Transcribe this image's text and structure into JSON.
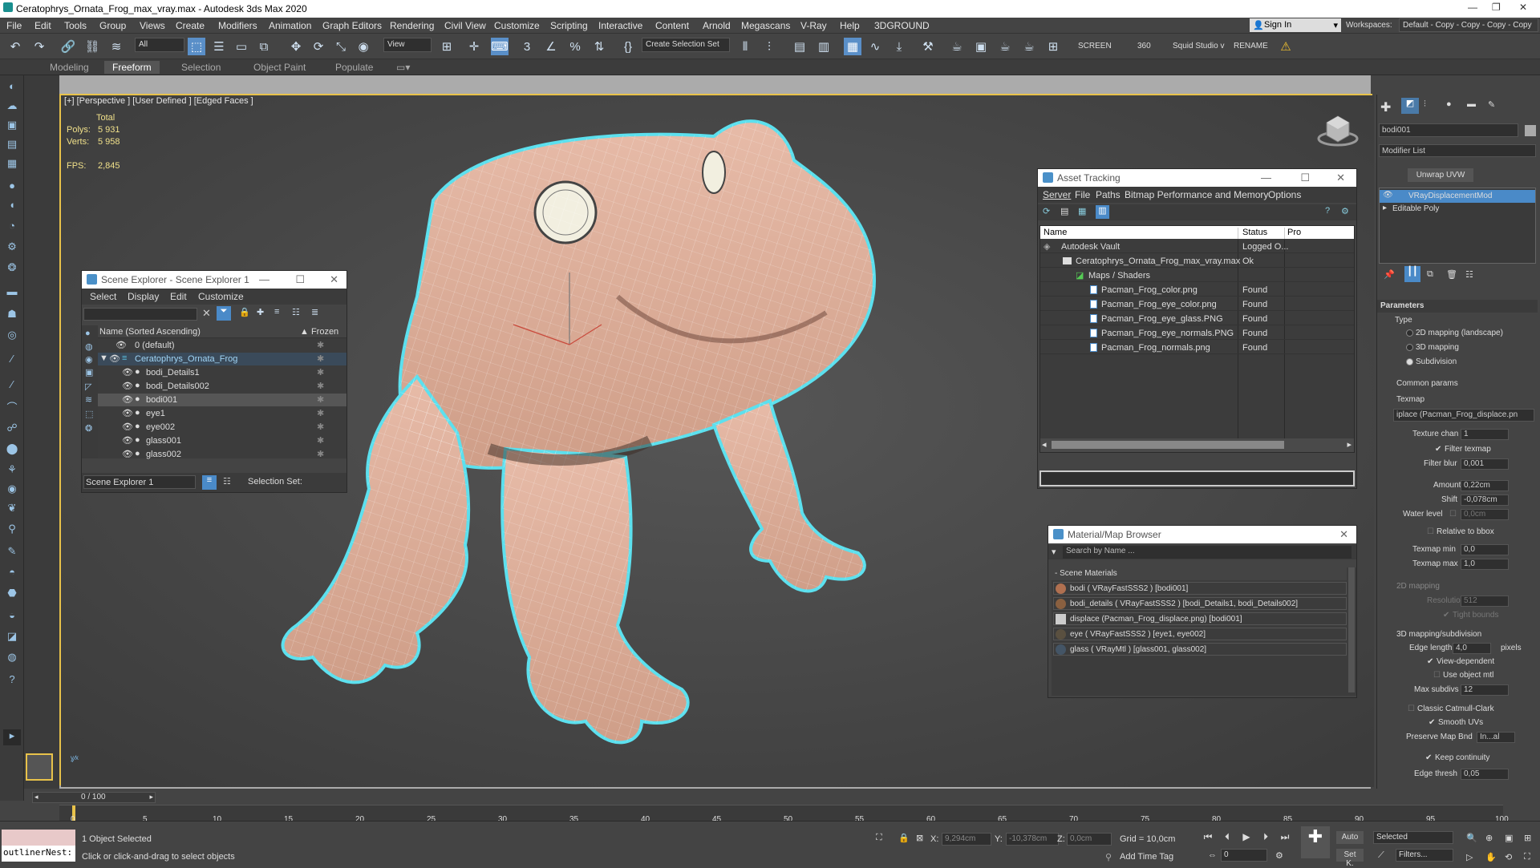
{
  "title_bar": {
    "text": "Ceratophrys_Ornata_Frog_max_vray.max - Autodesk 3ds Max 2020"
  },
  "menu": [
    "File",
    "Edit",
    "Tools",
    "Group",
    "Views",
    "Create",
    "Modifiers",
    "Animation",
    "Graph Editors",
    "Rendering",
    "Civil View",
    "Customize",
    "Scripting",
    "Interactive",
    "Content",
    "Arnold",
    "Megascans",
    "V-Ray",
    "Help",
    "3DGROUND"
  ],
  "account": {
    "sign_in": "Sign In",
    "workspaces_label": "Workspaces:",
    "workspace_value": "Default - Copy - Copy - Copy - Copy"
  },
  "toolbar": {
    "filter_all": "All",
    "ref_coord": "View",
    "selection_set": "Create Selection Set",
    "screen": "SCREEN",
    "angle": "360",
    "squid": "Squid Studio v",
    "rename": "RENAME"
  },
  "ribbon": {
    "tabs": [
      "Modeling",
      "Freeform",
      "Selection",
      "Object Paint",
      "Populate"
    ],
    "active": "Freeform"
  },
  "viewport": {
    "label": "[+] [Perspective ] [User Defined ] [Edged Faces ]",
    "stats": {
      "total": "Total",
      "polys_label": "Polys:",
      "polys": "5 931",
      "verts_label": "Verts:",
      "verts": "5 958",
      "fps_label": "FPS:",
      "fps": "2,845"
    }
  },
  "scene_explorer": {
    "title": "Scene Explorer - Scene Explorer 1",
    "menu": [
      "Select",
      "Display",
      "Edit",
      "Customize"
    ],
    "col_name": "Name (Sorted Ascending)",
    "col_frozen": "▲ Frozen",
    "items": [
      "0 (default)",
      "Ceratophrys_Ornata_Frog",
      "bodi_Details1",
      "bodi_Details002",
      "bodi001",
      "eye1",
      "eye002",
      "glass001",
      "glass002"
    ],
    "footer_name": "Scene Explorer 1",
    "selection_set": "Selection Set:"
  },
  "asset_tracking": {
    "title": "Asset Tracking",
    "menu": [
      "Server",
      "File",
      "Paths",
      "Bitmap Performance and Memory",
      "Options"
    ],
    "col_name": "Name",
    "col_status": "Status",
    "col_pro": "Pro",
    "rows": [
      {
        "name": "Autodesk Vault",
        "status": "Logged O..."
      },
      {
        "name": "Ceratophrys_Ornata_Frog_max_vray.max",
        "status": "Ok"
      },
      {
        "name": "Maps / Shaders",
        "status": ""
      },
      {
        "name": "Pacman_Frog_color.png",
        "status": "Found"
      },
      {
        "name": "Pacman_Frog_eye_color.png",
        "status": "Found"
      },
      {
        "name": "Pacman_Frog_eye_glass.PNG",
        "status": "Found"
      },
      {
        "name": "Pacman_Frog_eye_normals.PNG",
        "status": "Found"
      },
      {
        "name": "Pacman_Frog_normals.png",
        "status": "Found"
      }
    ]
  },
  "material_browser": {
    "title": "Material/Map Browser",
    "search": "Search by Name ...",
    "section": "- Scene Materials",
    "items": [
      "bodi  ( VRayFastSSS2 )  [bodi001]",
      "bodi_details  ( VRayFastSSS2 )  [bodi_Details1, bodi_Details002]",
      "displace (Pacman_Frog_displace.png)  [bodi001]",
      "eye  ( VRayFastSSS2 )  [eye1, eye002]",
      "glass  ( VRayMtl )  [glass001, glass002]"
    ]
  },
  "command_panel": {
    "object_name": "bodi001",
    "modifier_list": "Modifier List",
    "unwrap": "Unwrap UVW",
    "stack": [
      "VRayDisplacementMod",
      "Editable Poly"
    ],
    "parameters": "Parameters",
    "type_label": "Type",
    "type_options": [
      "2D mapping (landscape)",
      "3D mapping",
      "Subdivision"
    ],
    "common": "Common params",
    "texmap_label": "Texmap",
    "texmap_value": "iplace (Pacman_Frog_displace.pn",
    "fields": [
      {
        "label": "Texture chan",
        "value": "1"
      },
      {
        "label": "Filter texmap",
        "value": ""
      },
      {
        "label": "Filter blur",
        "value": "0,001"
      },
      {
        "label": "Amount",
        "value": "0,22cm"
      },
      {
        "label": "Shift",
        "value": "-0,078cm"
      },
      {
        "label": "Water level",
        "value": "0,0cm"
      },
      {
        "label": "Relative to bbox",
        "value": ""
      },
      {
        "label": "Texmap min",
        "value": "0,0"
      },
      {
        "label": "Texmap max",
        "value": "1,0"
      }
    ],
    "mapping2d": "2D mapping",
    "resolution_label": "Resolution",
    "resolution": "512",
    "tight_bounds": "Tight bounds",
    "mapping3d": "3D mapping/subdivision",
    "edge_length_label": "Edge length",
    "edge_length": "4,0",
    "pixels": "pixels",
    "view_dependent": "View-dependent",
    "use_object_mtl": "Use object mtl",
    "max_subdivs_label": "Max subdivs",
    "max_subdivs": "12",
    "classic_cc": "Classic Catmull-Clark",
    "smooth_uvs": "Smooth UVs",
    "preserve_label": "Preserve Map Bnd",
    "preserve_value": "In...al",
    "keep_continuity": "Keep continuity",
    "edge_thresh_label": "Edge thresh",
    "edge_thresh": "0,05"
  },
  "timeline": {
    "frame": "0 / 100",
    "ticks": [
      "0",
      "5",
      "10",
      "15",
      "20",
      "25",
      "30",
      "35",
      "40",
      "45",
      "50",
      "55",
      "60",
      "65",
      "70",
      "75",
      "80",
      "85",
      "90",
      "95",
      "100"
    ]
  },
  "status": {
    "script_field": "outlinerNest:",
    "selected": "1 Object Selected",
    "prompt": "Click or click-and-drag to select objects",
    "x_label": "X:",
    "x": "9,294cm",
    "y_label": "Y:",
    "y": "-10,378cm",
    "z_label": "Z:",
    "z": "0,0cm",
    "grid": "Grid = 10,0cm",
    "add_time_tag": "Add Time Tag",
    "auto": "Auto",
    "set_k": "Set K.",
    "selected_dd": "Selected",
    "filters": "Filters...",
    "frame": "0"
  }
}
